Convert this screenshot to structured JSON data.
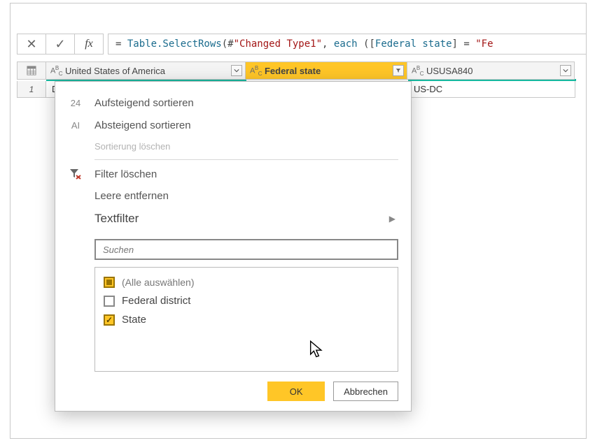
{
  "formula": {
    "prefix": "= ",
    "fn": "Table.SelectRows",
    "open": "(",
    "arg1_hash": "#",
    "arg1_str": "\"Changed Type1\"",
    "sep": ", ",
    "each_kw": "each",
    "space": " ",
    "open2": "(",
    "bracket_open": "[",
    "field": "Federal state",
    "bracket_close": "]",
    "eq": " = ",
    "val_start": "\"Fe"
  },
  "columns": [
    {
      "name": "United States of America"
    },
    {
      "name": "Federal state"
    },
    {
      "name": "USUSA840"
    }
  ],
  "row_number": "1",
  "cells": {
    "col1_partial": "D",
    "col3": "US-DC"
  },
  "dropdown": {
    "sort_asc_icon": "24",
    "sort_asc": "Aufsteigend sortieren",
    "sort_desc_icon": "AI",
    "sort_desc": "Absteigend sortieren",
    "clear_sort": "Sortierung löschen",
    "clear_filter": "Filter löschen",
    "remove_empty": "Leere entfernen",
    "text_filter": "Textfilter",
    "search_placeholder": "Suchen",
    "select_all": "(Alle auswählen)",
    "options": [
      {
        "label": "Federal district",
        "checked": false
      },
      {
        "label": "State",
        "checked": true
      }
    ],
    "ok": "OK",
    "cancel": "Abbrechen"
  }
}
